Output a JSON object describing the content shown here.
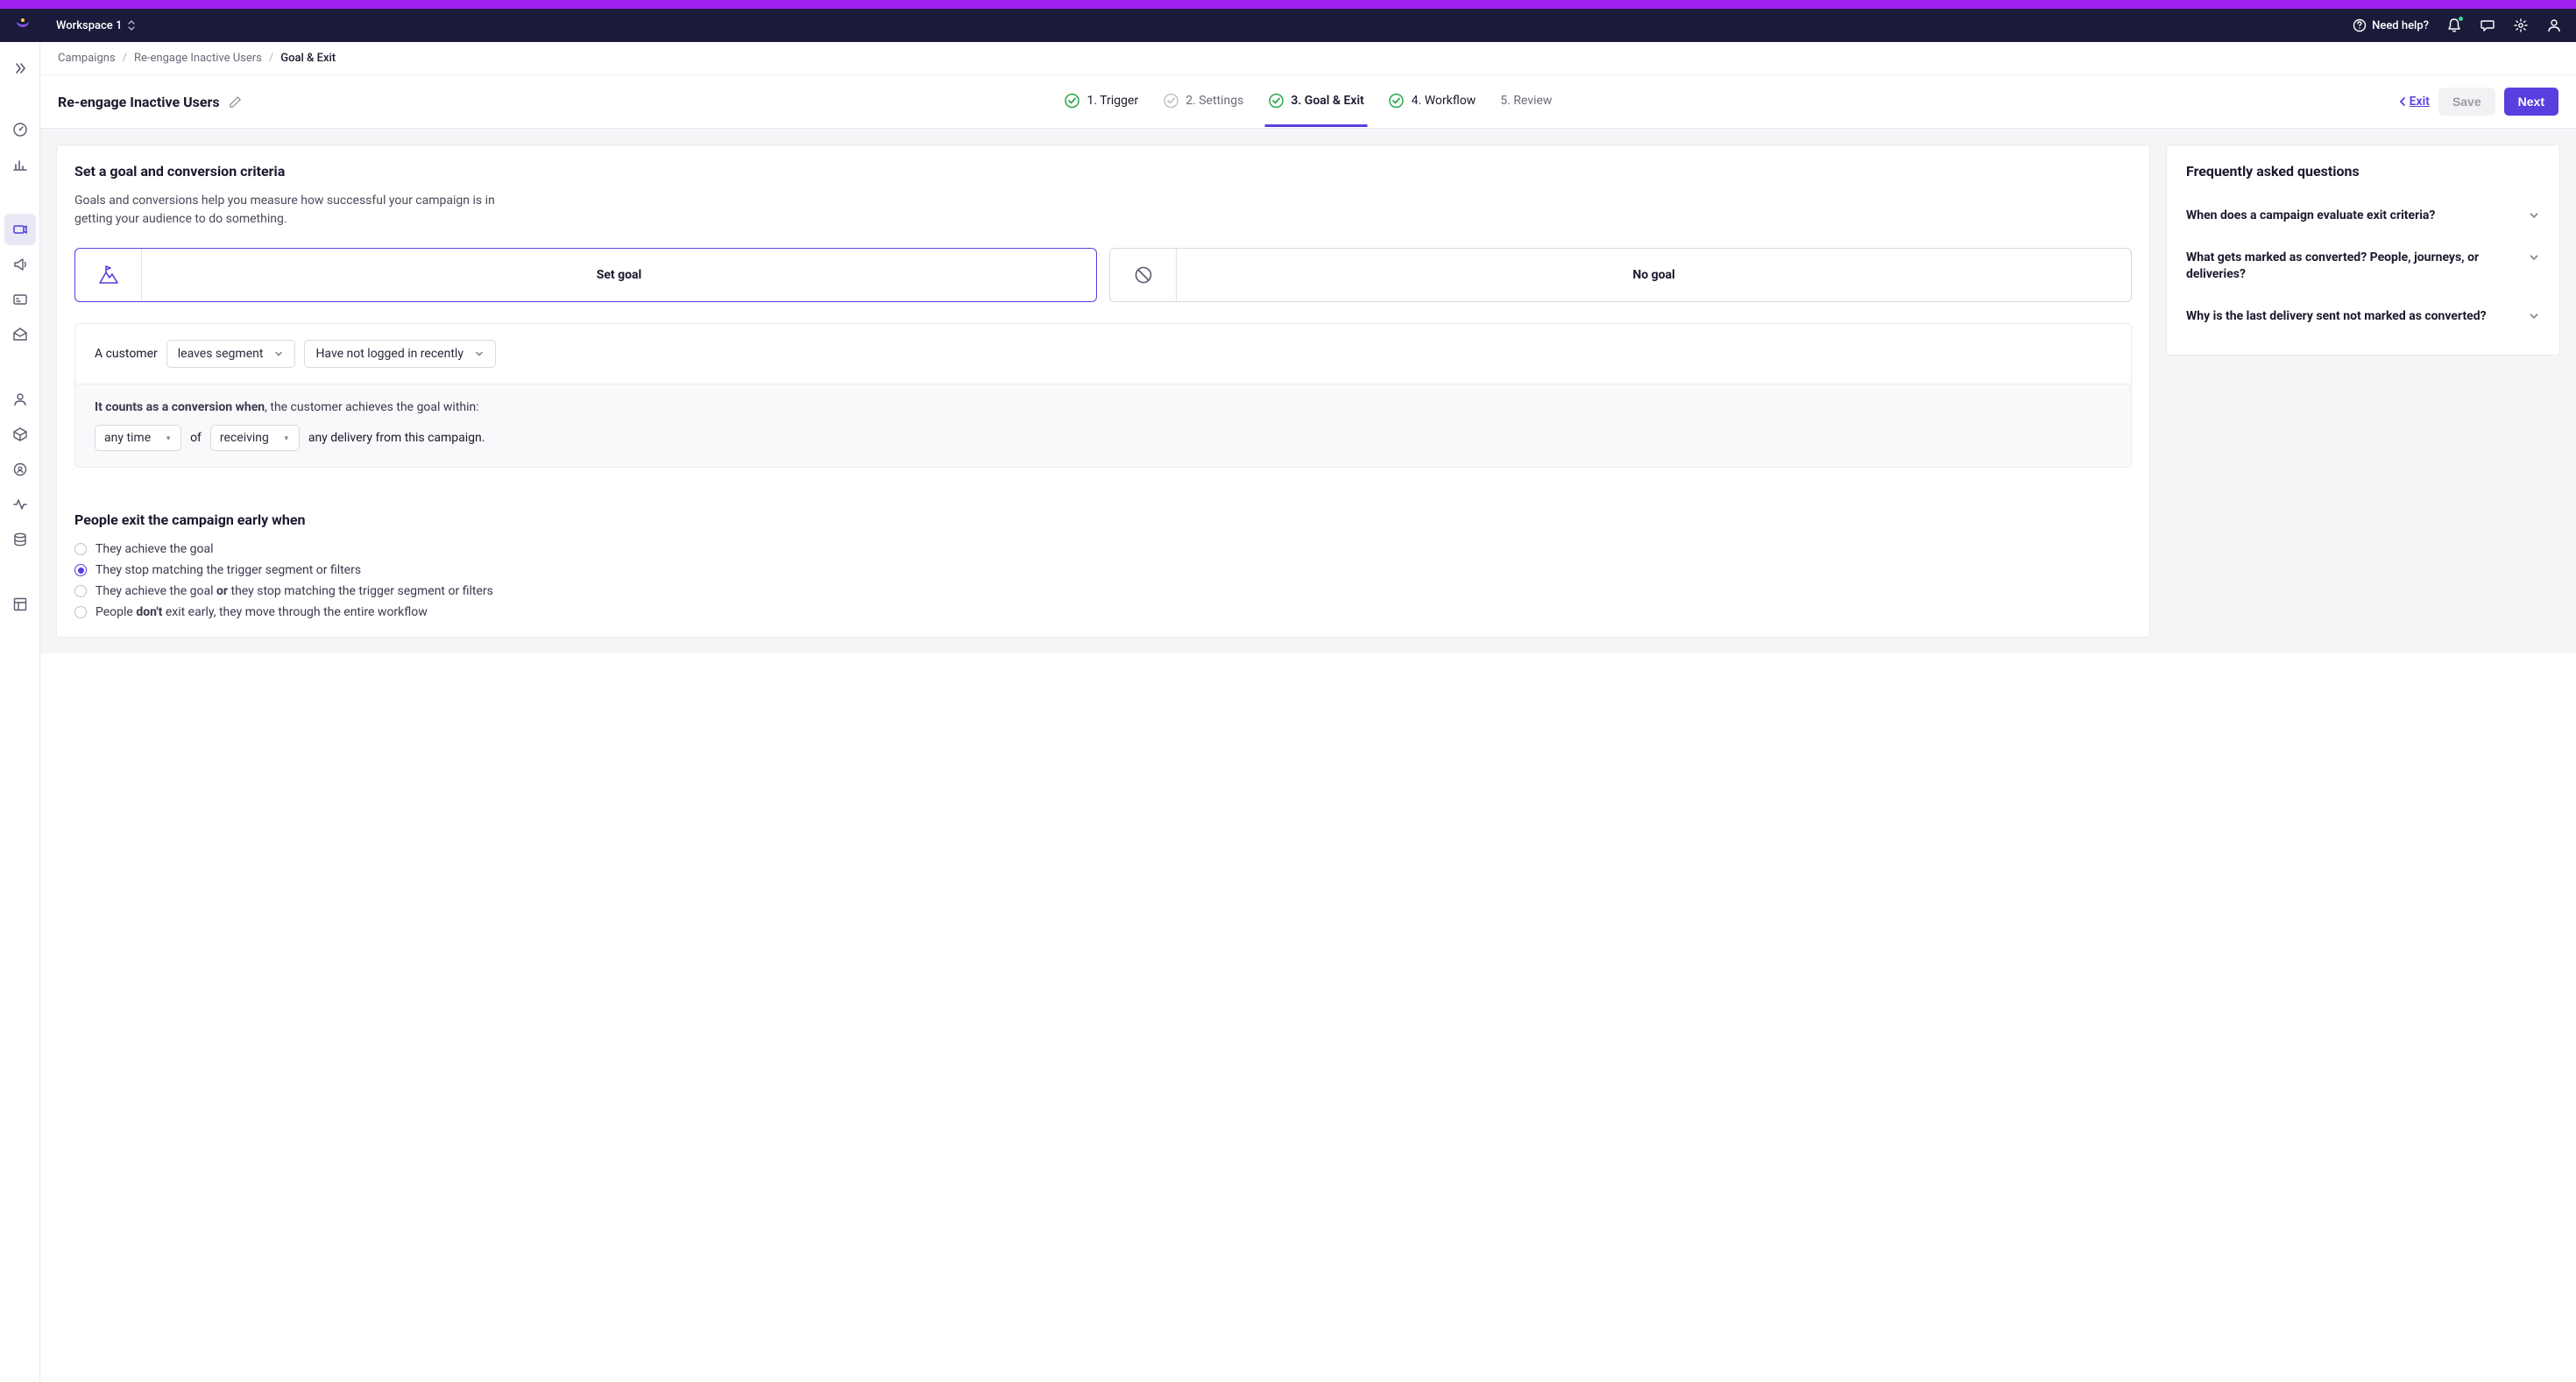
{
  "header": {
    "workspace": "Workspace 1",
    "help": "Need help?"
  },
  "breadcrumbs": {
    "c0": "Campaigns",
    "c1": "Re-engage Inactive Users",
    "c2": "Goal & Exit"
  },
  "page": {
    "title": "Re-engage Inactive Users",
    "exit_link": "Exit",
    "save": "Save",
    "next": "Next"
  },
  "steps": {
    "s1": "1. Trigger",
    "s2": "2. Settings",
    "s3": "3. Goal & Exit",
    "s4": "4. Workflow",
    "s5": "5. Review"
  },
  "goal": {
    "section_title": "Set a goal and conversion criteria",
    "section_desc": "Goals and conversions help you measure how successful your campaign is in getting your audience to do something.",
    "set_goal": "Set goal",
    "no_goal": "No goal",
    "a_customer": "A customer",
    "dd_action": "leaves segment",
    "dd_segment": "Have not logged in recently",
    "conv_lead_b": "It counts as a conversion when",
    "conv_lead_r": ", the customer achieves the goal within:",
    "dd_time": "any time",
    "of": "of",
    "dd_event": "receiving",
    "tail": "any delivery from this campaign."
  },
  "exit": {
    "title": "People exit the campaign early when",
    "o1": "They achieve the goal",
    "o2": "They stop matching the trigger segment or filters",
    "o3a": "They achieve the goal ",
    "o3b": "or",
    "o3c": " they stop matching the trigger segment or filters",
    "o4a": "People ",
    "o4b": "don't",
    "o4c": " exit early, they move through the entire workflow"
  },
  "faq": {
    "title": "Frequently asked questions",
    "q1": "When does a campaign evaluate exit criteria?",
    "q2": "What gets marked as converted? People, journeys, or deliveries?",
    "q3": "Why is the last delivery sent not marked as converted?"
  }
}
